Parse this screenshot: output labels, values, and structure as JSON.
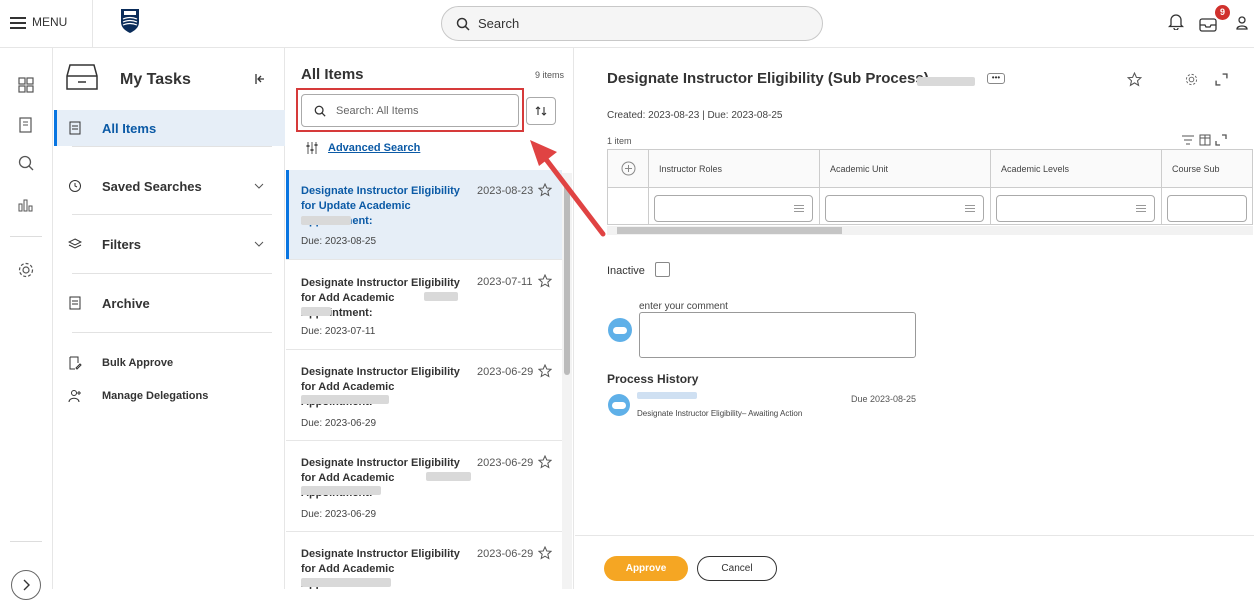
{
  "topbar": {
    "menu_label": "MENU",
    "search_placeholder": "Search",
    "notifications_count": "9"
  },
  "tasks_panel": {
    "title": "My Tasks",
    "nav": [
      {
        "label": "All Items"
      },
      {
        "label": "Saved Searches"
      },
      {
        "label": "Filters"
      },
      {
        "label": "Archive"
      },
      {
        "label": "Bulk Approve"
      },
      {
        "label": "Manage Delegations"
      }
    ]
  },
  "items_panel": {
    "title": "All Items",
    "count": "9 items",
    "search_placeholder": "Search: All Items",
    "advanced_search": "Advanced Search",
    "items": [
      {
        "title": "Designate Instructor Eligibility for Update Academic Appointment:",
        "date": "2023-08-23",
        "due": "Due: 2023-08-25"
      },
      {
        "title": "Designate Instructor Eligibility for Add Academic Appointment:",
        "date": "2023-07-11",
        "due": "Due: 2023-07-11"
      },
      {
        "title": "Designate Instructor Eligibility for Add Academic Appointment:",
        "date": "2023-06-29",
        "due": "Due: 2023-06-29"
      },
      {
        "title": "Designate Instructor Eligibility for Add Academic Appointment:",
        "date": "2023-06-29",
        "due": "Due: 2023-06-29"
      },
      {
        "title": "Designate Instructor Eligibility for Add Academic Appointment:",
        "date": "2023-06-29",
        "due": ""
      }
    ]
  },
  "detail": {
    "title": "Designate Instructor Eligibility (Sub Process)",
    "more_label": "•••",
    "created": "Created: 2023-08-23 | Due: 2023-08-25",
    "item_count": "1 item",
    "columns": [
      "Instructor Roles",
      "Academic Unit",
      "Academic Levels",
      "Course Sub"
    ],
    "inactive_label": "Inactive",
    "comment_placeholder": "enter your comment",
    "process_history_title": "Process History",
    "history_due": "Due 2023-08-25",
    "history_action": "Designate Instructor Eligibility– Awaiting Action",
    "approve_label": "Approve",
    "cancel_label": "Cancel"
  },
  "colors": {
    "accent_blue": "#0875e1",
    "approve_orange": "#f5a623",
    "highlight_red": "#d63a3a",
    "badge_red": "#d0312d"
  }
}
